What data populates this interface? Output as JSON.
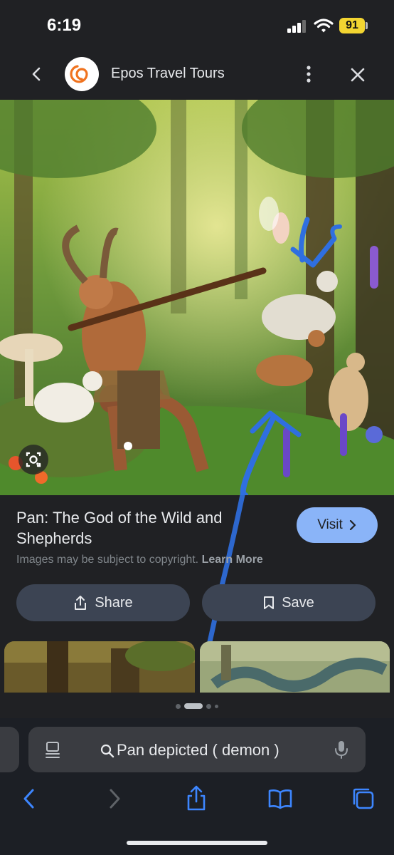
{
  "status": {
    "time": "6:19",
    "battery": "91"
  },
  "header": {
    "title": "Epos Travel Tours"
  },
  "result": {
    "title": "Pan: The God of the Wild and Shepherds",
    "visit_label": "Visit",
    "copyright_text": "Images may be subject to copyright.",
    "learn_more_label": "Learn More",
    "share_label": "Share",
    "save_label": "Save"
  },
  "carousel": {
    "dots": 4,
    "active_dot": 1
  },
  "browser": {
    "search_query": "Pan depicted ( demon )"
  },
  "colors": {
    "accent": "#8ab4f8",
    "background": "#202124",
    "battery": "#f3d531",
    "annotation": "#2f6fe0"
  }
}
